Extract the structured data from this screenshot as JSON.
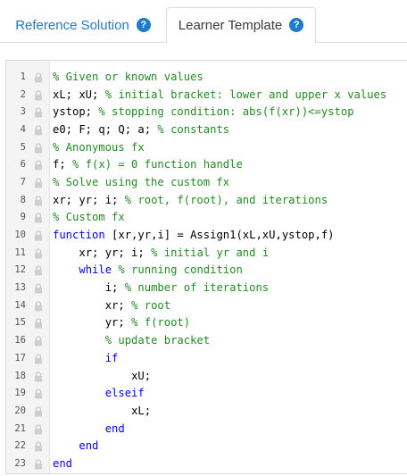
{
  "tabs": [
    {
      "label": "Reference Solution",
      "active": false
    },
    {
      "label": "Learner Template",
      "active": true
    }
  ],
  "help_icon_glyph": "?",
  "colors": {
    "tab_link": "#2479c0",
    "help_icon": "#1f7ac8",
    "keyword": "#0000ff",
    "comment": "#228b22"
  },
  "editor": {
    "lines": [
      {
        "num": "1",
        "indent": "",
        "segments": [
          {
            "t": "c",
            "s": "% Given or known values"
          }
        ]
      },
      {
        "num": "2",
        "indent": "",
        "segments": [
          {
            "t": "n",
            "s": "xL; xU; "
          },
          {
            "t": "c",
            "s": "% initial bracket: lower and upper x values"
          }
        ]
      },
      {
        "num": "3",
        "indent": "",
        "segments": [
          {
            "t": "n",
            "s": "ystop; "
          },
          {
            "t": "c",
            "s": "% stopping condition: abs(f(xr))<=ystop"
          }
        ]
      },
      {
        "num": "4",
        "indent": "",
        "segments": [
          {
            "t": "n",
            "s": "e0; F; q; Q; a; "
          },
          {
            "t": "c",
            "s": "% constants"
          }
        ]
      },
      {
        "num": "5",
        "indent": "",
        "segments": [
          {
            "t": "c",
            "s": "% Anonymous fx"
          }
        ]
      },
      {
        "num": "6",
        "indent": "",
        "segments": [
          {
            "t": "n",
            "s": "f; "
          },
          {
            "t": "c",
            "s": "% f(x) = 0 function handle"
          }
        ]
      },
      {
        "num": "7",
        "indent": "",
        "segments": [
          {
            "t": "c",
            "s": "% Solve using the custom fx"
          }
        ]
      },
      {
        "num": "8",
        "indent": "",
        "segments": [
          {
            "t": "n",
            "s": "xr; yr; i; "
          },
          {
            "t": "c",
            "s": "% root, f(root), and iterations"
          }
        ]
      },
      {
        "num": "9",
        "indent": "",
        "segments": [
          {
            "t": "c",
            "s": "% Custom fx"
          }
        ]
      },
      {
        "num": "10",
        "indent": "",
        "segments": [
          {
            "t": "k",
            "s": "function"
          },
          {
            "t": "n",
            "s": " [xr,yr,i] = Assign1(xL,xU,ystop,f)"
          }
        ]
      },
      {
        "num": "11",
        "indent": "    ",
        "segments": [
          {
            "t": "n",
            "s": "xr; yr; i; "
          },
          {
            "t": "c",
            "s": "% initial yr and i"
          }
        ]
      },
      {
        "num": "12",
        "indent": "    ",
        "segments": [
          {
            "t": "k",
            "s": "while"
          },
          {
            "t": "n",
            "s": " "
          },
          {
            "t": "c",
            "s": "% running condition"
          }
        ]
      },
      {
        "num": "13",
        "indent": "        ",
        "segments": [
          {
            "t": "n",
            "s": "i; "
          },
          {
            "t": "c",
            "s": "% number of iterations"
          }
        ]
      },
      {
        "num": "14",
        "indent": "        ",
        "segments": [
          {
            "t": "n",
            "s": "xr; "
          },
          {
            "t": "c",
            "s": "% root"
          }
        ]
      },
      {
        "num": "15",
        "indent": "        ",
        "segments": [
          {
            "t": "n",
            "s": "yr; "
          },
          {
            "t": "c",
            "s": "% f(root)"
          }
        ]
      },
      {
        "num": "16",
        "indent": "        ",
        "segments": [
          {
            "t": "c",
            "s": "% update bracket"
          }
        ]
      },
      {
        "num": "17",
        "indent": "        ",
        "segments": [
          {
            "t": "k",
            "s": "if"
          }
        ]
      },
      {
        "num": "18",
        "indent": "            ",
        "segments": [
          {
            "t": "n",
            "s": "xU;"
          }
        ]
      },
      {
        "num": "19",
        "indent": "        ",
        "segments": [
          {
            "t": "k",
            "s": "elseif"
          }
        ]
      },
      {
        "num": "20",
        "indent": "            ",
        "segments": [
          {
            "t": "n",
            "s": "xL;"
          }
        ]
      },
      {
        "num": "21",
        "indent": "        ",
        "segments": [
          {
            "t": "k",
            "s": "end"
          }
        ]
      },
      {
        "num": "22",
        "indent": "    ",
        "segments": [
          {
            "t": "k",
            "s": "end"
          }
        ]
      },
      {
        "num": "23",
        "indent": "",
        "segments": [
          {
            "t": "k",
            "s": "end"
          }
        ]
      }
    ]
  }
}
